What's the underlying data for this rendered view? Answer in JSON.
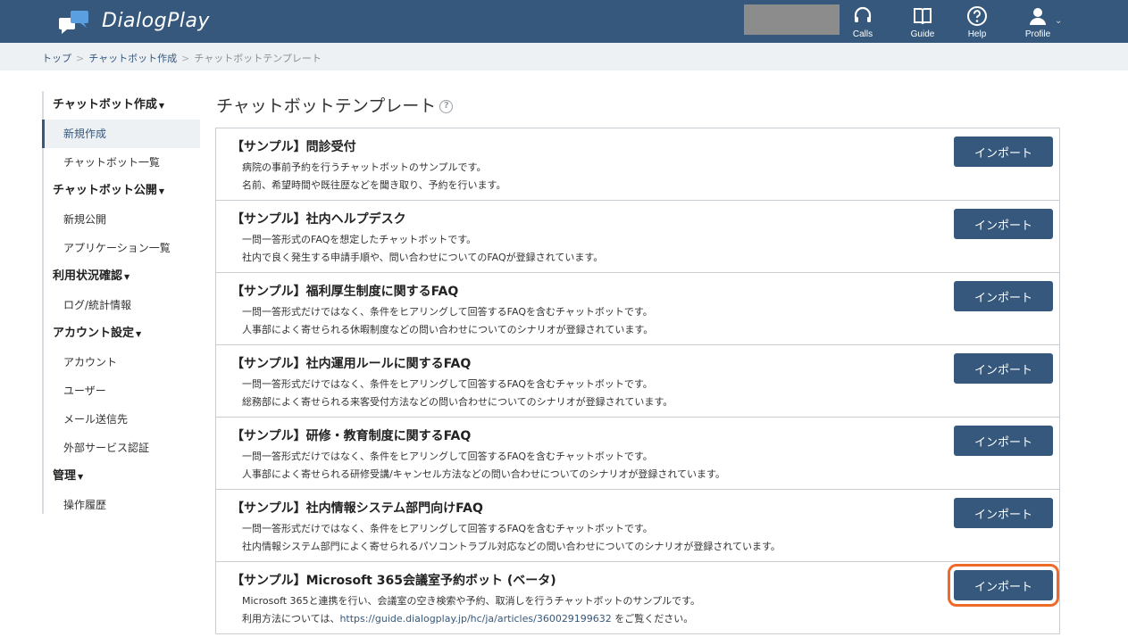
{
  "header": {
    "brand": "DialogPlay",
    "nav": [
      {
        "label": "Calls",
        "icon": "headset-icon"
      },
      {
        "label": "Guide",
        "icon": "book-icon"
      },
      {
        "label": "Help",
        "icon": "help-circle-icon"
      },
      {
        "label": "Profile",
        "icon": "user-icon"
      }
    ]
  },
  "breadcrumb": {
    "items": [
      "トップ",
      "チャットボット作成",
      "チャットボットテンプレート"
    ],
    "separator": ">"
  },
  "sidebar": {
    "sections": [
      {
        "title": "チャットボット作成",
        "items": [
          "新規作成",
          "チャットボット一覧"
        ]
      },
      {
        "title": "チャットボット公開",
        "items": [
          "新規公開",
          "アプリケーション一覧"
        ]
      },
      {
        "title": "利用状況確認",
        "items": [
          "ログ/統計情報"
        ]
      },
      {
        "title": "アカウント設定",
        "items": [
          "アカウント",
          "ユーザー",
          "メール送信先",
          "外部サービス認証"
        ]
      },
      {
        "title": "管理",
        "items": [
          "操作履歴"
        ]
      }
    ],
    "active_item": "新規作成"
  },
  "main": {
    "title": "チャットボットテンプレート",
    "help_icon": "?",
    "import_label": "インポート",
    "templates": [
      {
        "title": "【サンプル】問診受付",
        "line1": "病院の事前予約を行うチャットボットのサンプルです。",
        "line2": "名前、希望時間や既往歴などを聞き取り、予約を行います。"
      },
      {
        "title": "【サンプル】社内ヘルプデスク",
        "line1": "一問一答形式のFAQを想定したチャットボットです。",
        "line2": "社内で良く発生する申請手順や、問い合わせについてのFAQが登録されています。"
      },
      {
        "title": "【サンプル】福利厚生制度に関するFAQ",
        "line1": "一問一答形式だけではなく、条件をヒアリングして回答するFAQを含むチャットボットです。",
        "line2": "人事部によく寄せられる休暇制度などの問い合わせについてのシナリオが登録されています。"
      },
      {
        "title": "【サンプル】社内運用ルールに関するFAQ",
        "line1": "一問一答形式だけではなく、条件をヒアリングして回答するFAQを含むチャットボットです。",
        "line2": "総務部によく寄せられる来客受付方法などの問い合わせについてのシナリオが登録されています。"
      },
      {
        "title": "【サンプル】研修・教育制度に関するFAQ",
        "line1": "一問一答形式だけではなく、条件をヒアリングして回答するFAQを含むチャットボットです。",
        "line2": "人事部によく寄せられる研修受講/キャンセル方法などの問い合わせについてのシナリオが登録されています。"
      },
      {
        "title": "【サンプル】社内情報システム部門向けFAQ",
        "line1": "一問一答形式だけではなく、条件をヒアリングして回答するFAQを含むチャットボットです。",
        "line2": "社内情報システム部門によく寄せられるパソコントラブル対応などの問い合わせについてのシナリオが登録されています。"
      },
      {
        "title": "【サンプル】Microsoft 365会議室予約ボット (ベータ)",
        "line1": "Microsoft 365と連携を行い、会議室の空き検索や予約、取消しを行うチャットボットのサンプルです。",
        "line2_prefix": "利用方法については、",
        "line2_link": "https://guide.dialogplay.jp/hc/ja/articles/360029199632",
        "line2_suffix": " をご覧ください。"
      }
    ]
  },
  "colors": {
    "header_bg": "#35587c",
    "button_bg": "#35587c",
    "highlight": "#ee6a28",
    "breadcrumb_bg": "#eef1f4"
  }
}
